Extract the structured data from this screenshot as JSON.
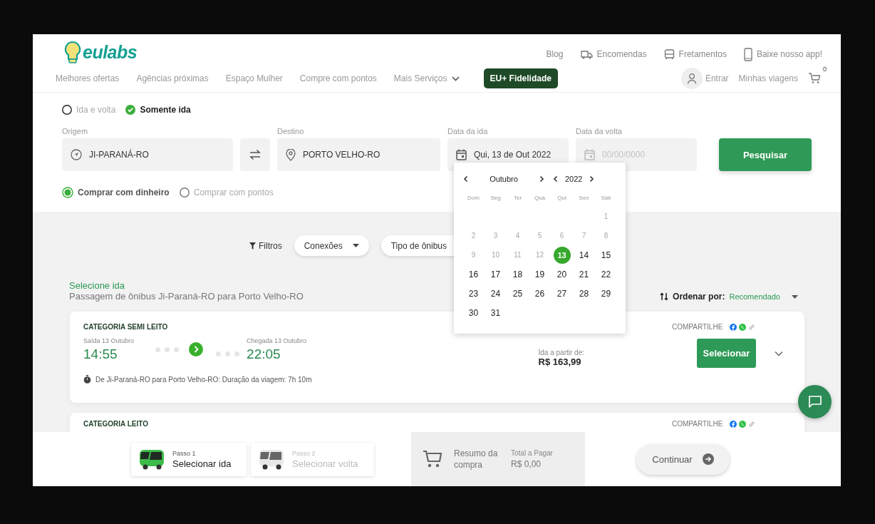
{
  "logo": {
    "text": "eulabs"
  },
  "top_links": [
    {
      "label": "Blog"
    },
    {
      "label": "Encomendas"
    },
    {
      "label": "Fretamentos"
    },
    {
      "label": "Baixe nosso app!"
    }
  ],
  "nav": [
    {
      "label": "Melhores ofertas",
      "kind": "link"
    },
    {
      "label": "Agências próximas",
      "kind": "link"
    },
    {
      "label": "Espaço Mulher",
      "kind": "link"
    },
    {
      "label": "Compre com pontos",
      "kind": "link"
    },
    {
      "label": "Mais Serviços",
      "kind": "dropdown"
    }
  ],
  "loyalty_button": "EU+ Fidelidade",
  "account": {
    "login": "Entrar",
    "trips": "Minhas viagens",
    "cart_count": "0"
  },
  "trip_types": [
    {
      "label": "Ida e volta",
      "selected": false
    },
    {
      "label": "Somente ida",
      "selected": true
    }
  ],
  "fields": {
    "origin": {
      "label": "Origem",
      "value": "JI-PARANÁ-RO"
    },
    "destination": {
      "label": "Destino",
      "value": "PORTO VELHO-RO"
    },
    "departure_date": {
      "label": "Data da ida",
      "value": "Qui, 13 de Out 2022"
    },
    "return_date": {
      "label": "Data da volta",
      "placeholder": "00/00/0000"
    }
  },
  "search_button": "Pesquisar",
  "payment_options": [
    {
      "label": "Comprar com dinheiro",
      "selected": true
    },
    {
      "label": "Comprar com pontos",
      "selected": false
    }
  ],
  "calendar": {
    "month": "Outubro",
    "year": "2022",
    "weekdays": [
      "Dom",
      "Seg",
      "Ter",
      "Qua",
      "Qui",
      "Sex",
      "Sáb"
    ],
    "weeks": [
      [
        {
          "day": "1",
          "disabled": true,
          "selected": false
        }
      ],
      [
        {
          "day": "2",
          "disabled": true,
          "selected": false
        },
        {
          "day": "3",
          "disabled": true,
          "selected": false
        },
        {
          "day": "4",
          "disabled": true,
          "selected": false
        },
        {
          "day": "5",
          "disabled": true,
          "selected": false
        },
        {
          "day": "6",
          "disabled": true,
          "selected": false
        },
        {
          "day": "7",
          "disabled": true,
          "selected": false
        },
        {
          "day": "8",
          "disabled": true,
          "selected": false
        }
      ],
      [
        {
          "day": "9",
          "disabled": true,
          "selected": false
        },
        {
          "day": "10",
          "disabled": true,
          "selected": false
        },
        {
          "day": "11",
          "disabled": true,
          "selected": false
        },
        {
          "day": "12",
          "disabled": true,
          "selected": false
        },
        {
          "day": "13",
          "disabled": false,
          "selected": true
        },
        {
          "day": "14",
          "disabled": false,
          "selected": false
        },
        {
          "day": "15",
          "disabled": false,
          "selected": false
        }
      ],
      [
        {
          "day": "16",
          "disabled": false,
          "selected": false
        },
        {
          "day": "17",
          "disabled": false,
          "selected": false
        },
        {
          "day": "18",
          "disabled": false,
          "selected": false
        },
        {
          "day": "19",
          "disabled": false,
          "selected": false
        },
        {
          "day": "20",
          "disabled": false,
          "selected": false
        },
        {
          "day": "21",
          "disabled": false,
          "selected": false
        },
        {
          "day": "22",
          "disabled": false,
          "selected": false
        }
      ],
      [
        {
          "day": "23",
          "disabled": false,
          "selected": false
        },
        {
          "day": "24",
          "disabled": false,
          "selected": false
        },
        {
          "day": "25",
          "disabled": false,
          "selected": false
        },
        {
          "day": "26",
          "disabled": false,
          "selected": false
        },
        {
          "day": "27",
          "disabled": false,
          "selected": false
        },
        {
          "day": "28",
          "disabled": false,
          "selected": false
        },
        {
          "day": "29",
          "disabled": false,
          "selected": false
        }
      ],
      [
        {
          "day": "30",
          "disabled": false,
          "selected": false
        },
        {
          "day": "31",
          "disabled": false,
          "selected": false
        }
      ]
    ]
  },
  "filters": {
    "label": "Filtros",
    "dropdowns": [
      "Conexões",
      "Tipo de ônibus"
    ]
  },
  "results_header": {
    "title": "Selecione ida",
    "subtitle": "Passagem de ônibus Ji-Paraná-RO para Porto Velho-RO",
    "sort_label": "Ordenar por:",
    "sort_value": "Recomendado"
  },
  "trips": [
    {
      "category": "CATEGORIA SEMI LEITO",
      "departure_label": "Saída 13 Outubro",
      "departure_time": "14:55",
      "arrival_label": "Chegada 13 Outubro",
      "arrival_time": "22:05",
      "duration": "De Ji-Paraná-RO para Porto Velho-RO: Duração da viagem: 7h 10m",
      "price_label": "Ida a partir de:",
      "price": "R$ 163,99",
      "share_label": "COMPARTILHE",
      "select_button": "Selecionar"
    },
    {
      "category": "CATEGORIA LEITO",
      "share_label": "COMPARTILHE"
    }
  ],
  "steps": [
    {
      "step": "Passo 1",
      "label": "Selecionar ida",
      "active": true
    },
    {
      "step": "Passo 2",
      "label": "Selecionar volta",
      "active": false
    }
  ],
  "summary": {
    "title": "Resumo da compra",
    "total_label": "Total a Pagar",
    "total": "R$ 0,00"
  },
  "continue_button": {
    "label": "Continuar",
    "disabled": true
  }
}
